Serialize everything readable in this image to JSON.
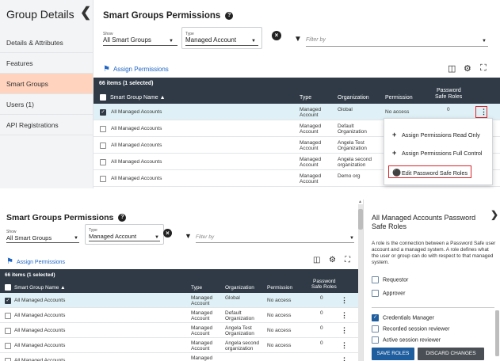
{
  "top": {
    "sidebar": {
      "title": "Group Details",
      "collapse_icon": "chevron-left-icon",
      "items": [
        {
          "label": "Details & Attributes",
          "active": false
        },
        {
          "label": "Features",
          "active": false
        },
        {
          "label": "Smart Groups",
          "active": true
        },
        {
          "label": "Users (1)",
          "active": false
        },
        {
          "label": "API Registrations",
          "active": false
        }
      ]
    },
    "title": "Smart Groups Permissions",
    "show_label": "Show",
    "show_value": "All Smart Groups",
    "type_label": "Type",
    "type_value": "Managed Account",
    "filter_placeholder": "Filter by",
    "assign_label": "Assign Permissions",
    "count_label": "66 items (1 selected)",
    "columns": {
      "name": "Smart Group Name ▲",
      "type": "Type",
      "org": "Organization",
      "perm": "Permission",
      "pwd_line1": "Password",
      "pwd_line2": "Safe Roles"
    },
    "rows": [
      {
        "name": "All Managed Accounts",
        "type": "Managed Account",
        "org": "Global",
        "perm": "No access",
        "roles": "0",
        "selected": true
      },
      {
        "name": "All Managed Accounts",
        "type": "Managed Account",
        "org": "Default Organization",
        "perm": "N",
        "roles": "",
        "selected": false
      },
      {
        "name": "All Managed Accounts",
        "type": "Managed Account",
        "org": "Angela Test Organization",
        "perm": "N",
        "roles": "",
        "selected": false
      },
      {
        "name": "All Managed Accounts",
        "type": "Managed Account",
        "org": "Angela second organization",
        "perm": "N",
        "roles": "",
        "selected": false
      },
      {
        "name": "All Managed Accounts",
        "type": "Managed Account",
        "org": "Demo org",
        "perm": "N",
        "roles": "",
        "selected": false
      }
    ],
    "menu": {
      "read_only": "Assign Permissions Read Only",
      "full_control": "Assign Permissions Full Control",
      "edit_roles": "Edit Password Safe Roles"
    }
  },
  "bottom": {
    "title": "Smart Groups Permissions",
    "show_label": "Show",
    "show_value": "All Smart Groups",
    "type_label": "Type",
    "type_value": "Managed Account",
    "filter_placeholder": "Filter by",
    "assign_label": "Assign Permissions",
    "count_label": "66 items (1 selected)",
    "columns": {
      "name": "Smart Group Name ▲",
      "type": "Type",
      "org": "Organization",
      "perm": "Permission",
      "pwd_line1": "Password",
      "pwd_line2": "Safe Roles"
    },
    "rows": [
      {
        "name": "All Managed Accounts",
        "type": "Managed Account",
        "org": "Global",
        "perm": "No access",
        "roles": "0",
        "selected": true
      },
      {
        "name": "All Managed Accounts",
        "type": "Managed Account",
        "org": "Default Organization",
        "perm": "No access",
        "roles": "0",
        "selected": false
      },
      {
        "name": "All Managed Accounts",
        "type": "Managed Account",
        "org": "Angela Test Organization",
        "perm": "No access",
        "roles": "0",
        "selected": false
      },
      {
        "name": "All Managed Accounts",
        "type": "Managed Account",
        "org": "Angela second organization",
        "perm": "No access",
        "roles": "0",
        "selected": false
      },
      {
        "name": "All Managed Accounts",
        "type": "Managed",
        "org": "",
        "perm": "",
        "roles": "",
        "selected": false
      }
    ],
    "pane": {
      "title": "All Managed Accounts Password Safe Roles",
      "description": "A role is the connection between a Password Safe user account and a managed system. A role defines what the user or group can do with respect to that managed system.",
      "roles_a": [
        {
          "label": "Requestor",
          "checked": false
        },
        {
          "label": "Approver",
          "checked": false
        }
      ],
      "roles_b": [
        {
          "label": "Credentials Manager",
          "checked": true
        },
        {
          "label": "Recorded session reviewer",
          "checked": false
        },
        {
          "label": "Active session reviewer",
          "checked": false
        }
      ],
      "save_label": "SAVE ROLES",
      "discard_label": "DISCARD CHANGES"
    }
  },
  "colors": {
    "accent": "#1f5e9e",
    "header": "#2f3a46",
    "active_nav": "#ffd3bd",
    "highlight": "#d9262c"
  }
}
